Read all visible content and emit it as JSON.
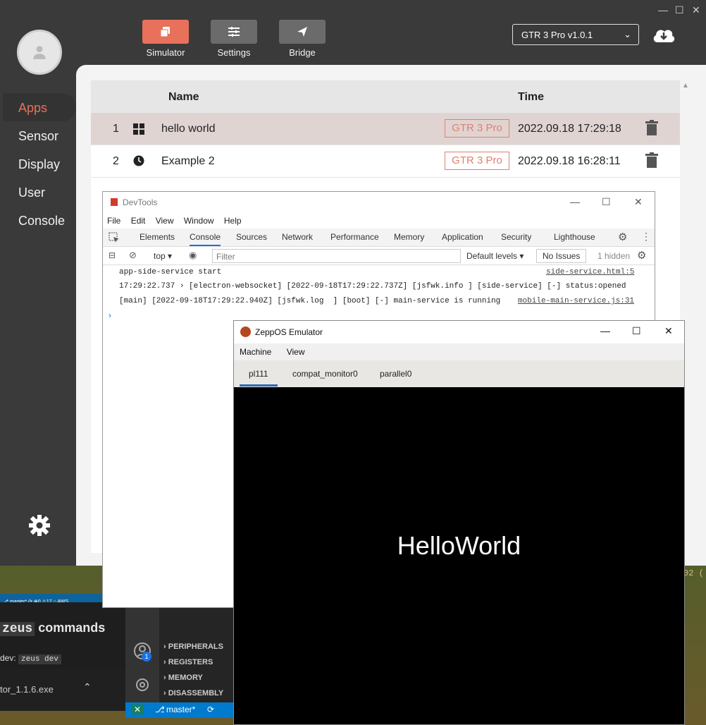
{
  "simulator": {
    "window_controls": [
      "—",
      "☐",
      "✕"
    ],
    "toolbar": [
      {
        "label": "Simulator",
        "active": true
      },
      {
        "label": "Settings",
        "active": false
      },
      {
        "label": "Bridge",
        "active": false
      }
    ],
    "device_select": "GTR 3 Pro v1.0.1",
    "sidebar": [
      "Apps",
      "Sensor",
      "Display",
      "User",
      "Console"
    ],
    "table": {
      "headers": {
        "name": "Name",
        "time": "Time"
      },
      "rows": [
        {
          "index": "1",
          "name": "hello world",
          "device": "GTR 3 Pro",
          "time": "2022.09.18 17:29:18",
          "icon": "grid-icon"
        },
        {
          "index": "2",
          "name": "Example 2",
          "device": "GTR 3 Pro",
          "time": "2022.09.18 16:28:11",
          "icon": "clock-icon"
        }
      ]
    },
    "accent": "#e8715b"
  },
  "devtools": {
    "title": "DevTools",
    "menu": [
      "File",
      "Edit",
      "View",
      "Window",
      "Help"
    ],
    "tabs": [
      "Elements",
      "Console",
      "Sources",
      "Network",
      "Performance",
      "Memory",
      "Application",
      "Security",
      "Lighthouse"
    ],
    "active_tab": "Console",
    "context": "top",
    "filter_placeholder": "Filter",
    "levels": "Default levels",
    "issues": "No Issues",
    "hidden": "1 hidden",
    "logs": [
      {
        "text": "app-side-service start",
        "source": "side-service.html:5"
      },
      {
        "text": "17:29:22.737 › [electron-websocket] [2022-09-18T17:29:22.737Z] [jsfwk.info ] [side-service] [-] status:opened",
        "source": ""
      },
      {
        "text": "[main] [2022-09-18T17:29:22.940Z] [jsfwk.log  ] [boot] [-] main-service is running",
        "source": "mobile-main-service.js:31"
      }
    ],
    "prompt": "›"
  },
  "emulator": {
    "title": "ZeppOS Emulator",
    "menu": [
      "Machine",
      "View"
    ],
    "tabs": [
      "pl111",
      "compat_monitor0",
      "parallel0"
    ],
    "screen_text": "HelloWorld"
  },
  "vscode": {
    "status_top": "⎇ master* ⟳ ⊗0 ⚠17 ⌂ AWS",
    "zeus_word": "zeus",
    "commands_word": "commands",
    "dev_label": "dev:",
    "dev_code": "zeus dev",
    "taskbar_file": "tor_1.1.6.exe",
    "panel_items": [
      "PERIPHERALS",
      "REGISTERS",
      "MEMORY",
      "DISASSEMBLY"
    ],
    "branch": "master*",
    "badge": "1",
    "code_fragment": "02 ("
  }
}
